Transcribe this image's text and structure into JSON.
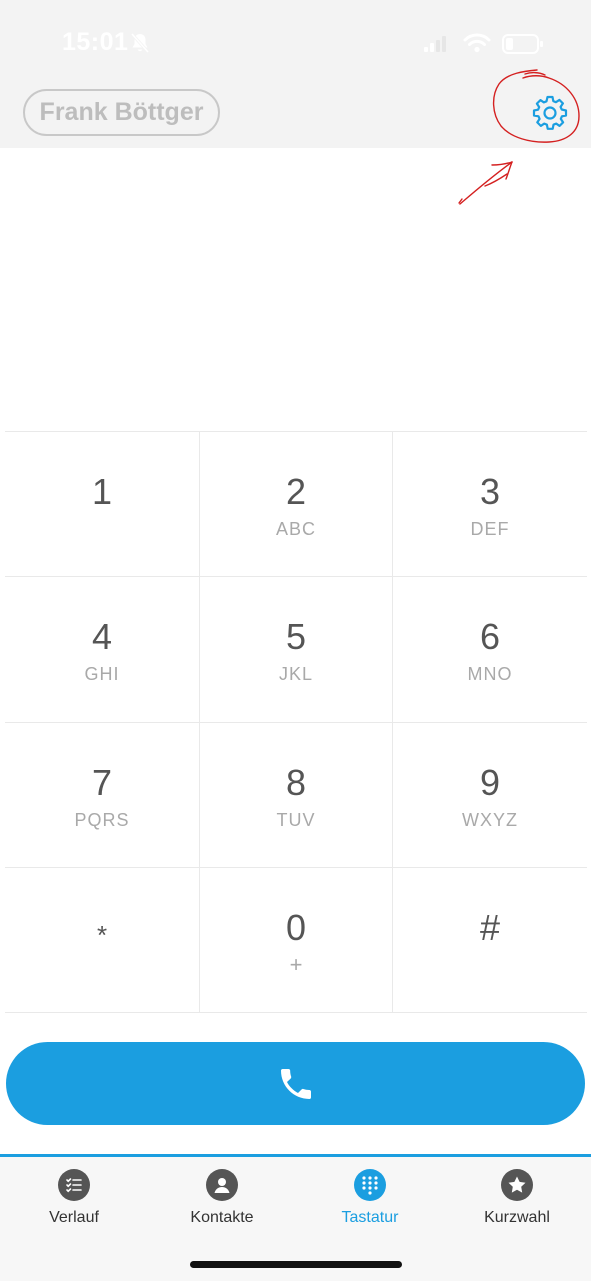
{
  "status_bar": {
    "time": "15:01",
    "icons": [
      "bell-muted-icon",
      "signal-icon",
      "wifi-icon",
      "battery-icon"
    ]
  },
  "header": {
    "user_name": "Frank Böttger",
    "settings_icon": "gear-icon"
  },
  "keypad": {
    "keys": [
      {
        "digit": "1",
        "letters": ""
      },
      {
        "digit": "2",
        "letters": "ABC"
      },
      {
        "digit": "3",
        "letters": "DEF"
      },
      {
        "digit": "4",
        "letters": "GHI"
      },
      {
        "digit": "5",
        "letters": "JKL"
      },
      {
        "digit": "6",
        "letters": "MNO"
      },
      {
        "digit": "7",
        "letters": "PQRS"
      },
      {
        "digit": "8",
        "letters": "TUV"
      },
      {
        "digit": "9",
        "letters": "WXYZ"
      },
      {
        "digit": "*",
        "letters": ""
      },
      {
        "digit": "0",
        "letters": "+"
      },
      {
        "digit": "#",
        "letters": ""
      }
    ]
  },
  "call_button": {
    "icon": "phone-icon"
  },
  "tabbar": {
    "tabs": [
      {
        "label": "Verlauf",
        "icon": "history-list-icon",
        "active": false
      },
      {
        "label": "Kontakte",
        "icon": "contact-person-icon",
        "active": false
      },
      {
        "label": "Tastatur",
        "icon": "keypad-grid-icon",
        "active": true
      },
      {
        "label": "Kurzwahl",
        "icon": "star-icon",
        "active": false
      }
    ]
  },
  "colors": {
    "accent": "#1b9ee0",
    "header_bg": "#f3f3f3",
    "annotation": "#d42020"
  }
}
